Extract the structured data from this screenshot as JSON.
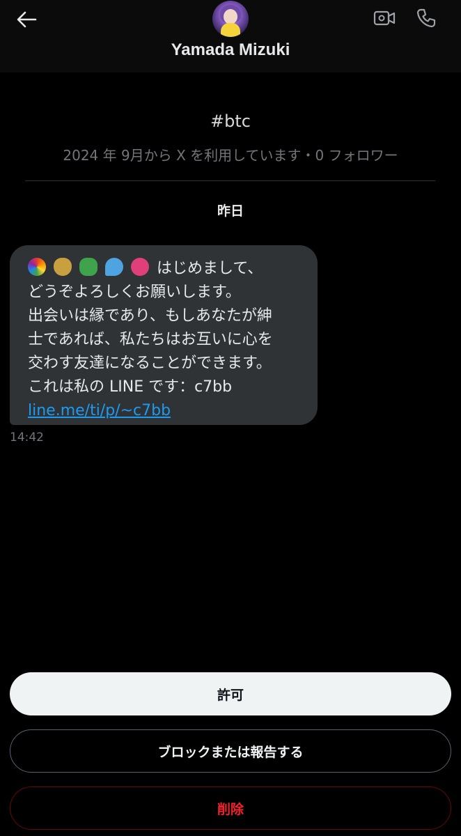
{
  "header": {
    "back_icon": "arrow-left-icon",
    "name": "Yamada Mizuki",
    "avatar": "profile-avatar",
    "video_icon": "video-camera-icon",
    "call_icon": "phone-icon"
  },
  "profile": {
    "handle": "#btc",
    "meta": "2024 年 9月から X を利用しています・0 フォロワー"
  },
  "conversation": {
    "date_separator": "昨日",
    "message": {
      "emojis": [
        "rainbow",
        "money-bag",
        "four-leaf-clover",
        "sweat-droplets",
        "hibiscus"
      ],
      "lines": [
        "はじめまして、",
        "どうぞよろしくお願いします。",
        "出会いは縁であり、もしあなたが紳",
        "士であれば、私たちはお互いに心を",
        "交わす友達になることができます。",
        "これは私の LINE です：c7bb"
      ],
      "link": "line.me/ti/p/~c7bb",
      "time": "14:42"
    }
  },
  "actions": {
    "allow_label": "許可",
    "block_label": "ブロックまたは報告する",
    "delete_label": "削除"
  },
  "colors": {
    "background": "#000000",
    "bubble": "#2f3336",
    "link": "#1d9bf0",
    "danger": "#f4212e",
    "muted": "#71767b"
  }
}
